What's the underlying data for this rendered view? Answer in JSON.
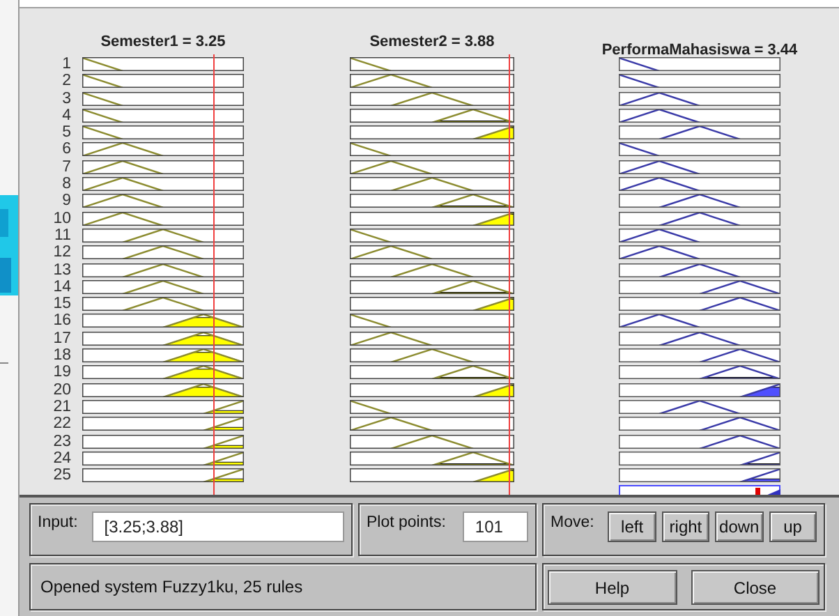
{
  "variables": [
    {
      "title": "Semester1 = 3.25"
    },
    {
      "title": "Semester2 = 3.88"
    },
    {
      "title": "PerformaMahasiswa = 3.44"
    }
  ],
  "rules": [
    {
      "number": "1"
    },
    {
      "number": "2"
    },
    {
      "number": "3"
    },
    {
      "number": "4"
    },
    {
      "number": "5"
    },
    {
      "number": "6"
    },
    {
      "number": "7"
    },
    {
      "number": "8"
    },
    {
      "number": "9"
    },
    {
      "number": "10"
    },
    {
      "number": "11"
    },
    {
      "number": "12"
    },
    {
      "number": "13"
    },
    {
      "number": "14"
    },
    {
      "number": "15"
    },
    {
      "number": "16"
    },
    {
      "number": "17"
    },
    {
      "number": "18"
    },
    {
      "number": "19"
    },
    {
      "number": "20"
    },
    {
      "number": "21"
    },
    {
      "number": "22"
    },
    {
      "number": "23"
    },
    {
      "number": "24"
    },
    {
      "number": "25"
    }
  ],
  "input": {
    "label": "Input:",
    "value": "[3.25;3.88]"
  },
  "plot_points": {
    "label": "Plot points:",
    "value": "101"
  },
  "move": {
    "label": "Move:",
    "buttons": [
      "left",
      "right",
      "down",
      "up"
    ]
  },
  "status": "Opened system Fuzzy1ku, 25 rules",
  "buttons": [
    "Help",
    "Close"
  ]
}
